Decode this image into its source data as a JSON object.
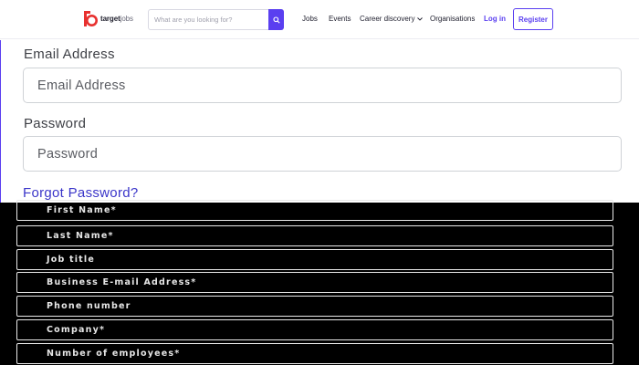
{
  "header": {
    "logo_text": "target",
    "logo_suffix": "jobs",
    "search_placeholder": "What are you looking for?",
    "nav": {
      "jobs": "Jobs",
      "events": "Events",
      "career": "Career discovery",
      "organisations": "Organisations",
      "login": "Log in",
      "register": "Register"
    },
    "brand_color": "#5a3ff0"
  },
  "login_form": {
    "email_label": "Email Address",
    "email_placeholder": "Email Address",
    "password_label": "Password",
    "password_placeholder": "Password",
    "forgot_link": "Forgot Password?"
  },
  "registration_fields": [
    "First Name*",
    "Last Name*",
    "Job title",
    "Business E-mail Address*",
    "Phone number",
    "Company*",
    "Number of employees*"
  ]
}
